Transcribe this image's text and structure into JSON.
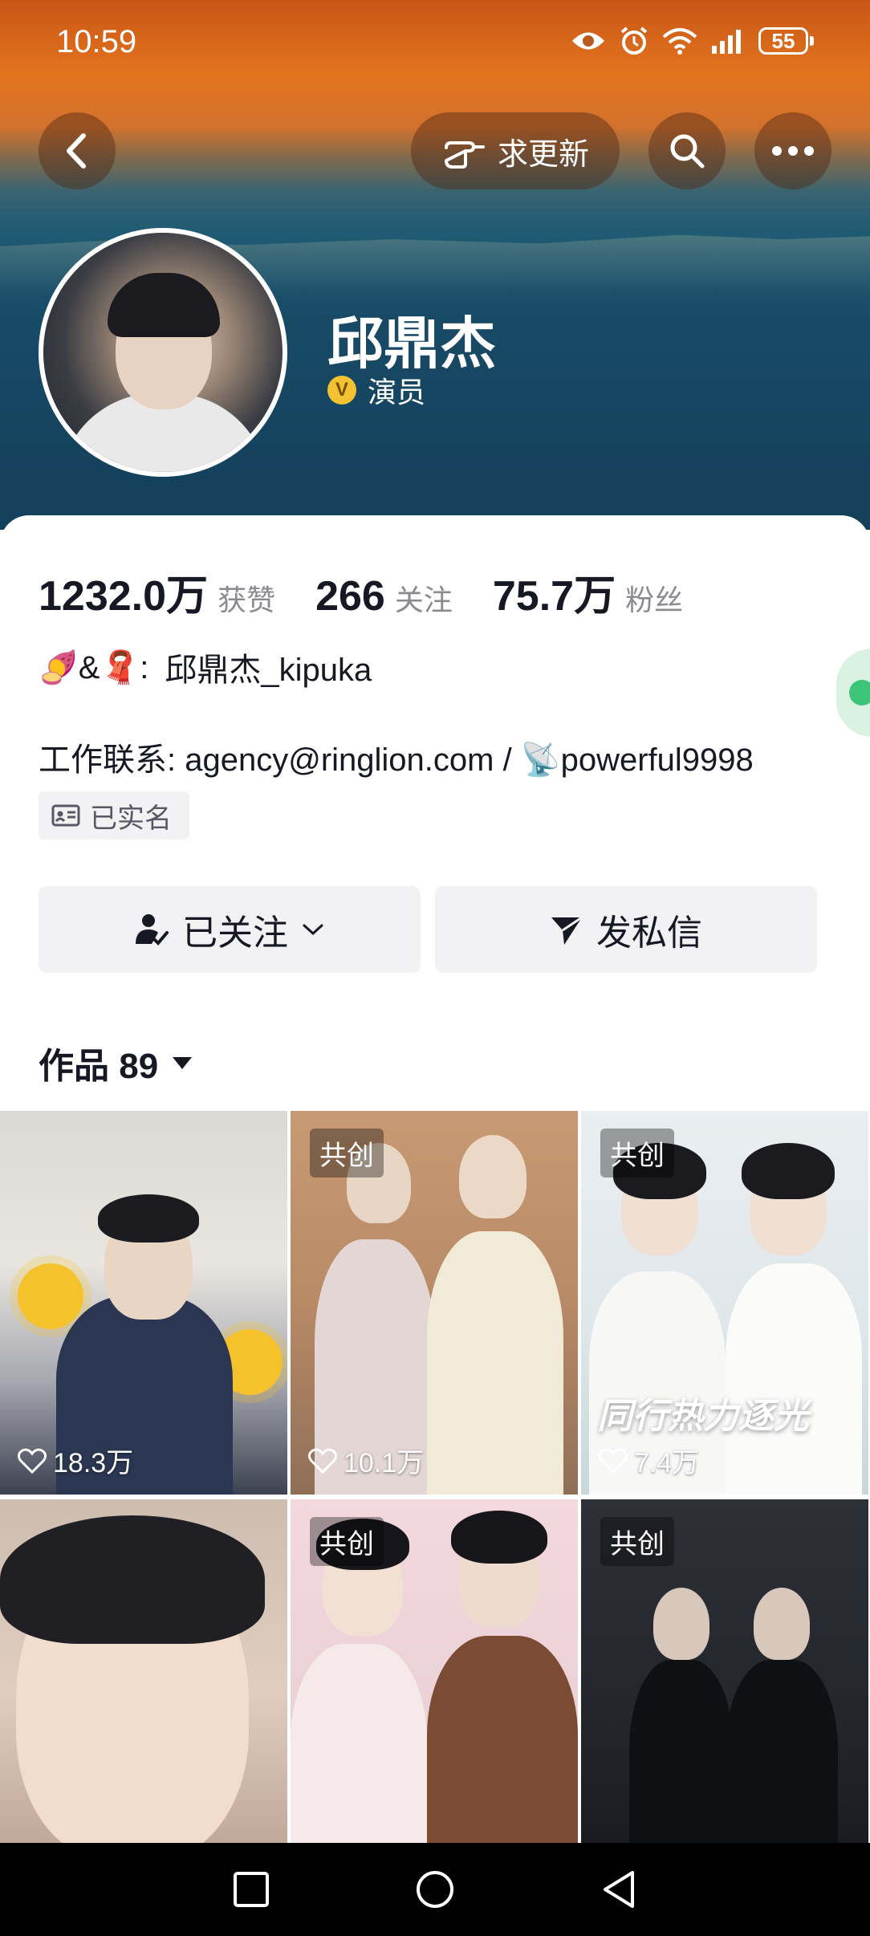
{
  "status_bar": {
    "time": "10:59",
    "battery": "55"
  },
  "header": {
    "request_update_label": "求更新",
    "back_icon": "chevron-left-icon",
    "search_icon": "search-icon",
    "more_icon": "more-icon"
  },
  "profile": {
    "name": "邱鼎杰",
    "verified_badge": "V",
    "title": "演员"
  },
  "stats": {
    "likes_value": "1232.0万",
    "likes_label": "获赞",
    "following_value": "266",
    "following_label": "关注",
    "fans_value": "75.7万",
    "fans_label": "粉丝"
  },
  "bio": {
    "line1_emoji": "🍠&🧣:",
    "line1_text": "邱鼎杰_kipuka",
    "line2": "工作联系:  agency@ringlion.com / 📡powerful9998",
    "verified_label": "已实名"
  },
  "actions": {
    "follow_label": "已关注",
    "message_label": "发私信"
  },
  "works": {
    "label": "作品 89"
  },
  "grid": [
    {
      "tag": "",
      "likes": "18.3万"
    },
    {
      "tag": "共创",
      "likes": "10.1万"
    },
    {
      "tag": "共创",
      "likes": "7.4万",
      "overlay": "同行热力逐光"
    },
    {
      "tag": "",
      "likes": ""
    },
    {
      "tag": "共创",
      "likes": ""
    },
    {
      "tag": "共创",
      "likes": ""
    }
  ],
  "colors": {
    "accent": "#f2c230",
    "card_bg": "#ffffff",
    "button_bg": "#f2f2f4"
  }
}
